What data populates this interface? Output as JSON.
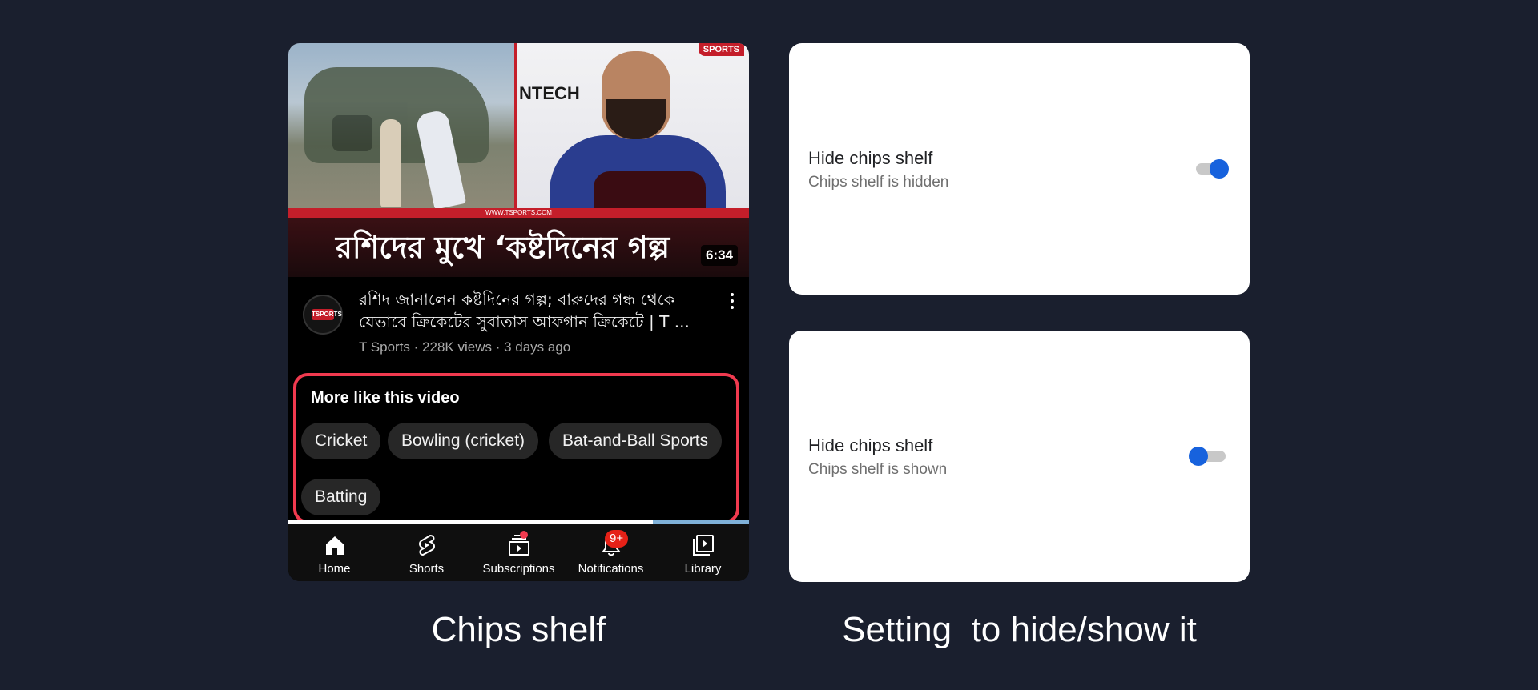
{
  "thumbnail": {
    "channel_logo": "SPORTS",
    "sponsor_1": "NTECH",
    "url_text": "WWW.TSPORTS.COM",
    "title_overlay": "রশিদের মুখে ‘কষ্টদিনের গল্প",
    "duration": "6:34"
  },
  "video": {
    "title": "রশিদ জানালেন কষ্টদিনের গল্প; বারুদের গন্ধ থেকে যেভাবে ক্রিকেটের সুবাতাস আফগান ক্রিকেটে | T ...",
    "meta": "T Sports · 228K views · 3 days ago",
    "avatar_text": "TSPORTS"
  },
  "chips_shelf": {
    "heading": "More like this video",
    "chips": [
      "Cricket",
      "Bowling (cricket)",
      "Bat-and-Ball Sports",
      "Batting"
    ]
  },
  "nav": {
    "items": [
      {
        "label": "Home",
        "icon": "home-icon"
      },
      {
        "label": "Shorts",
        "icon": "shorts-icon"
      },
      {
        "label": "Subscriptions",
        "icon": "subscriptions-icon"
      },
      {
        "label": "Notifications",
        "icon": "bell-icon",
        "badge": "9+"
      },
      {
        "label": "Library",
        "icon": "library-icon"
      }
    ]
  },
  "settings": [
    {
      "title": "Hide chips shelf",
      "subtitle": "Chips shelf is hidden",
      "enabled": true
    },
    {
      "title": "Hide chips shelf",
      "subtitle": "Chips shelf is shown",
      "enabled": false
    }
  ],
  "captions": {
    "left": "Chips shelf",
    "right": "Setting  to hide/show it"
  },
  "colors": {
    "background": "#1a1f2e",
    "highlight_border": "#f03a4f",
    "toggle_on": "#1762dd",
    "badge": "#e62117"
  }
}
